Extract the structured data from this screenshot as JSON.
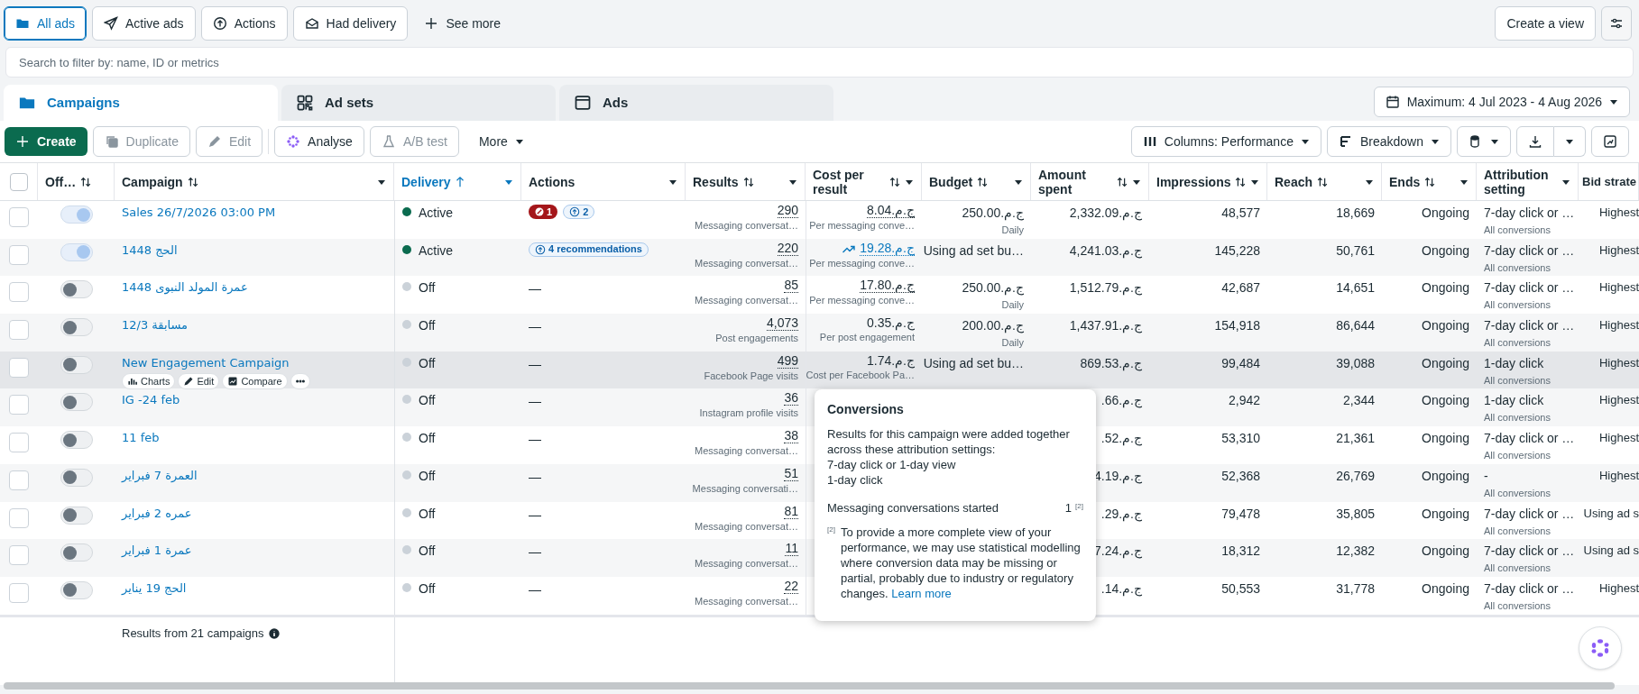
{
  "filters": [
    {
      "label": "All ads",
      "selected": true
    },
    {
      "label": "Active ads",
      "selected": false
    },
    {
      "label": "Actions",
      "selected": false
    },
    {
      "label": "Had delivery",
      "selected": false
    }
  ],
  "see_more": "See more",
  "create_view": "Create a view",
  "search": {
    "placeholder": "Search to filter by: name, ID or metrics"
  },
  "level_tabs": [
    {
      "label": "Campaigns",
      "selected": true
    },
    {
      "label": "Ad sets",
      "selected": false
    },
    {
      "label": "Ads",
      "selected": false
    }
  ],
  "date_range": "Maximum: 4 Jul 2023 - 4 Aug 2026",
  "toolbar": {
    "create": "Create",
    "duplicate": "Duplicate",
    "edit": "Edit",
    "analyse": "Analyse",
    "ab_test": "A/B test",
    "more": "More",
    "columns": "Columns: Performance",
    "breakdown": "Breakdown"
  },
  "select_all_checked": false,
  "columns": [
    {
      "label": "Off…",
      "kind": "sort"
    },
    {
      "label": "Campaign",
      "kind": "sort-menu"
    },
    {
      "label": "Delivery",
      "kind": "sorted-menu"
    },
    {
      "label": "Actions",
      "kind": "menu"
    },
    {
      "label": "Results",
      "kind": "sort-menu"
    },
    {
      "label": "Cost per result",
      "kind": "sort-menu"
    },
    {
      "label": "Budget",
      "kind": "sort-menu"
    },
    {
      "label": "Amount spent",
      "kind": "sort-menu"
    },
    {
      "label": "Impressions",
      "kind": "sort-menu"
    },
    {
      "label": "Reach",
      "kind": "sort-menu"
    },
    {
      "label": "Ends",
      "kind": "sort-menu"
    },
    {
      "label": "Attribution setting",
      "kind": "menu"
    },
    {
      "label": "Bid strate",
      "kind": "plain"
    }
  ],
  "rows": [
    {
      "on": true,
      "hovered": false,
      "checked": false,
      "campaign": "Sales 26/7/2026 03:00 PM",
      "delivery": "Active",
      "delivery_active": true,
      "actions": [
        {
          "kind": "error",
          "label": "1"
        },
        {
          "kind": "recommendation",
          "label": "2"
        }
      ],
      "results": "290",
      "results_sub": "Messaging conversat…",
      "cost": "8.04.ج.م",
      "cost_dotted": true,
      "trend": false,
      "cost_sub": "Per messaging conve…",
      "budget": "250.00.ج.م",
      "budget_sub": "Daily",
      "amount": "2,332.09.ج.م",
      "impressions": "48,577",
      "reach": "18,669",
      "ends": "Ongoing",
      "attribution": "7-day click or …",
      "attribution_sub": "All conversions",
      "bid": "Highest"
    },
    {
      "on": true,
      "hovered": false,
      "checked": false,
      "campaign": "الحج 1448",
      "delivery": "Active",
      "delivery_active": true,
      "actions": [
        {
          "kind": "recommendation",
          "label": "4 recommendations"
        }
      ],
      "results": "220",
      "results_sub": "Messaging conversat…",
      "cost": "19.28.ج.م",
      "cost_dotted": true,
      "trend": true,
      "cost_sub": "Per messaging conve…",
      "budget": "Using ad set bu…",
      "amount": "4,241.03.ج.م",
      "impressions": "145,228",
      "reach": "50,761",
      "ends": "Ongoing",
      "attribution": "7-day click or …",
      "attribution_sub": "All conversions",
      "bid": "Highest"
    },
    {
      "on": false,
      "hovered": false,
      "checked": false,
      "campaign": "عمرة المولد النبوى 1448",
      "delivery": "Off",
      "delivery_active": false,
      "actions": [],
      "no_actions": "—",
      "results": "85",
      "results_sub": "Messaging conversat…",
      "cost": "17.80.ج.م",
      "cost_dotted": true,
      "trend": false,
      "cost_sub": "Per messaging conve…",
      "budget": "250.00.ج.م",
      "budget_sub": "Daily",
      "amount": "1,512.79.ج.م",
      "impressions": "42,687",
      "reach": "14,651",
      "ends": "Ongoing",
      "attribution": "7-day click or …",
      "attribution_sub": "All conversions",
      "bid": "Highest"
    },
    {
      "on": false,
      "hovered": false,
      "checked": false,
      "campaign": "مسابقة 12/3",
      "delivery": "Off",
      "delivery_active": false,
      "actions": [],
      "no_actions": "—",
      "results": "4,073",
      "results_sub": "Post engagements",
      "cost": "0.35.ج.م",
      "cost_dotted": false,
      "trend": false,
      "cost_sub": "Per post engagement",
      "budget": "200.00.ج.م",
      "budget_sub": "Daily",
      "amount": "1,437.91.ج.م",
      "impressions": "154,918",
      "reach": "86,644",
      "ends": "Ongoing",
      "attribution": "7-day click or …",
      "attribution_sub": "All conversions",
      "bid": "Highest"
    },
    {
      "on": false,
      "hovered": true,
      "quick_actions": [
        "Charts",
        "Edit",
        "Compare"
      ],
      "checked": false,
      "campaign": "New Engagement Campaign",
      "delivery": "Off",
      "delivery_active": false,
      "actions": [],
      "no_actions": "—",
      "results": "499",
      "results_sub": "Facebook Page visits",
      "cost": "1.74.ج.م",
      "cost_dotted": false,
      "trend": false,
      "cost_sub": "Cost per Facebook Pa…",
      "budget": "Using ad set bu…",
      "amount": "869.53.ج.م",
      "impressions": "99,484",
      "reach": "39,088",
      "ends": "Ongoing",
      "attribution": "1-day click",
      "attribution_sub": "All conversions",
      "bid": "Highest"
    },
    {
      "on": false,
      "hovered": false,
      "checked": false,
      "campaign": "IG -24 feb",
      "delivery": "Off",
      "delivery_active": false,
      "actions": [],
      "no_actions": "—",
      "results": "36",
      "results_sub": "Instagram profile visits",
      "amount": ".66.ج.م",
      "impressions": "2,942",
      "reach": "2,344",
      "ends": "Ongoing",
      "attribution": "1-day click",
      "attribution_sub": "All conversions",
      "bid": "Highest"
    },
    {
      "on": false,
      "hovered": false,
      "checked": false,
      "campaign": "11 feb",
      "delivery": "Off",
      "delivery_active": false,
      "actions": [],
      "no_actions": "—",
      "results": "38",
      "results_sub": "Messaging conversat…",
      "amount": ".52.ج.م",
      "impressions": "53,310",
      "reach": "21,361",
      "ends": "Ongoing",
      "attribution": "7-day click or …",
      "attribution_sub": "All conversions",
      "bid": "Highest"
    },
    {
      "on": false,
      "hovered": false,
      "checked": false,
      "campaign": "العمرة 7 فبراير",
      "delivery": "Off",
      "delivery_active": false,
      "actions": [],
      "no_actions": "—",
      "results": "51",
      "results_sub": "Messaging conversati…",
      "amount": "4.19.ج.م",
      "impressions": "52,368",
      "reach": "26,769",
      "ends": "Ongoing",
      "attribution": "-",
      "attribution_sub": "All conversions",
      "bid": "Highest"
    },
    {
      "on": false,
      "hovered": false,
      "checked": false,
      "campaign": "عمره 2 فبراير",
      "delivery": "Off",
      "delivery_active": false,
      "actions": [],
      "no_actions": "—",
      "results": "81",
      "results_sub": "Messaging conversat…",
      "amount": ".29.ج.م",
      "impressions": "79,478",
      "reach": "35,805",
      "ends": "Ongoing",
      "attribution": "7-day click or …",
      "attribution_sub": "All conversions",
      "bid": "Using ad s"
    },
    {
      "on": false,
      "hovered": false,
      "checked": false,
      "campaign": "عمرة 1 فبراير",
      "delivery": "Off",
      "delivery_active": false,
      "actions": [],
      "no_actions": "—",
      "results": "11",
      "results_sub": "Messaging conversat…",
      "amount": "7.24.ج.م",
      "impressions": "18,312",
      "reach": "12,382",
      "ends": "Ongoing",
      "attribution": "7-day click or …",
      "attribution_sub": "All conversions",
      "bid": "Using ad s"
    },
    {
      "on": false,
      "hovered": false,
      "checked": false,
      "campaign": "الحج 19 يناير",
      "delivery": "Off",
      "delivery_active": false,
      "actions": [],
      "no_actions": "—",
      "results": "22",
      "results_sub": "Messaging conversat…",
      "amount": ".14.ج.م",
      "impressions": "50,553",
      "reach": "31,778",
      "ends": "Ongoing",
      "attribution": "7-day click or …",
      "attribution_sub": "All conversions",
      "bid": "Highest"
    }
  ],
  "footer": "Results from 21 campaigns",
  "tooltip": {
    "title": "Conversions",
    "body": [
      "Results for this campaign were added together across these attribution settings:",
      "7-day click or 1-day view",
      "1-day click"
    ],
    "metric": "Messaging conversations started",
    "metric_value": "1",
    "metric_note": "[2]",
    "note_mark": "[2]",
    "note": "To provide a more complete view of your performance, we may use statistical modelling where conversion data may be missing or partial, probably due to industry or regulatory changes.",
    "link": "Learn more"
  }
}
